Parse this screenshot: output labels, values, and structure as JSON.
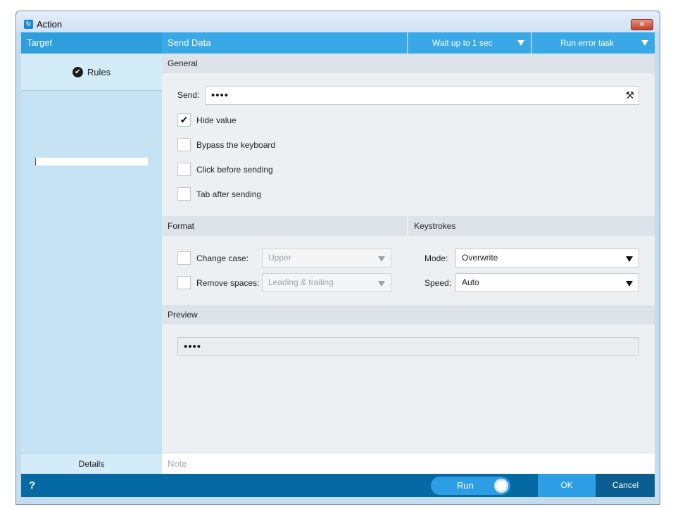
{
  "window": {
    "title": "Action",
    "close_glyph": "✕"
  },
  "header": {
    "target": "Target",
    "send_data": "Send Data",
    "wait": "Wait up to 1 sec",
    "error": "Run error task"
  },
  "left": {
    "rules": "Rules",
    "details": "Details"
  },
  "general": {
    "section": "General",
    "send_label": "Send:",
    "send_value": "••••",
    "options": [
      {
        "label": "Hide value",
        "checked": true
      },
      {
        "label": "Bypass the keyboard",
        "checked": false
      },
      {
        "label": "Click before sending",
        "checked": false
      },
      {
        "label": "Tab after sending",
        "checked": false
      }
    ]
  },
  "format": {
    "section": "Format",
    "change_case_label": "Change case:",
    "change_case_value": "Upper",
    "remove_spaces_label": "Remove spaces:",
    "remove_spaces_value": "Leading & trailing"
  },
  "keystrokes": {
    "section": "Keystrokes",
    "mode_label": "Mode:",
    "mode_value": "Overwrite",
    "speed_label": "Speed:",
    "speed_value": "Auto"
  },
  "preview": {
    "section": "Preview",
    "value": "••••"
  },
  "note_placeholder": "Note",
  "footer": {
    "help": "?",
    "run": "Run",
    "ok": "OK",
    "cancel": "Cancel"
  },
  "colors": {
    "accent": "#38a9e6",
    "footer": "#056aa4",
    "left_pane": "#c6e3f4"
  }
}
